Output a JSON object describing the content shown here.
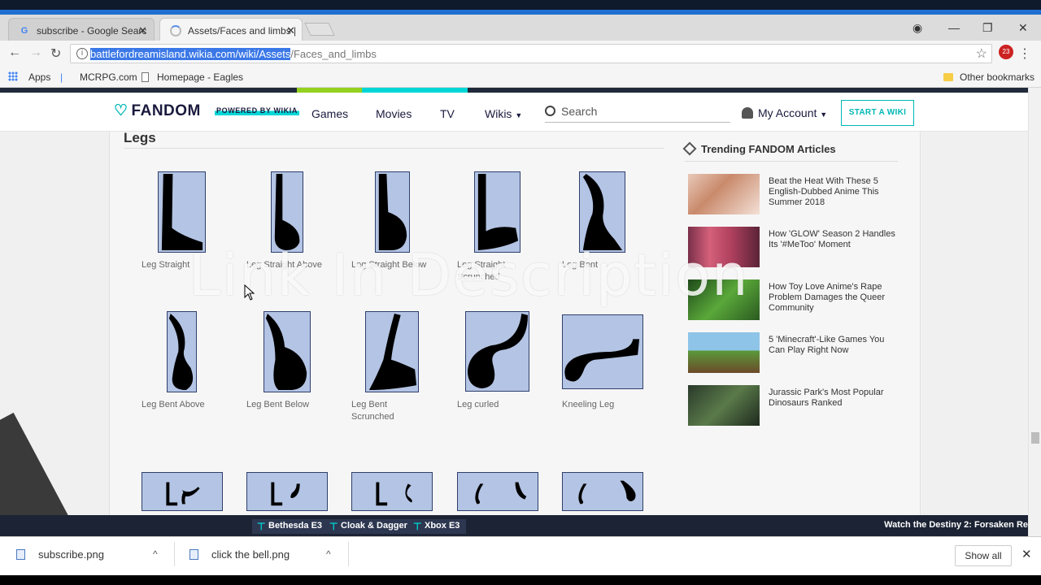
{
  "browser": {
    "tabs": [
      {
        "title": "subscribe - Google Searc",
        "favicon": "G",
        "active": false
      },
      {
        "title": "Assets/Faces and limbs |",
        "favicon": "",
        "active": true
      }
    ],
    "url_selected": "battlefordreamisland.wikia.com/wiki/Assets",
    "url_rest": "/Faces_and_limbs",
    "ext_badge": "23",
    "bookmarks": {
      "apps": "Apps",
      "mcrpg": "MCRPG.com",
      "eagles": "Homepage - Eagles",
      "other": "Other bookmarks"
    }
  },
  "fandom": {
    "logo": "FANDOM",
    "powered": "POWERED BY WIKIA",
    "nav": {
      "games": "Games",
      "movies": "Movies",
      "tv": "TV",
      "wikis": "Wikis"
    },
    "search_placeholder": "Search",
    "account": "My Account",
    "start_wiki": "START A WIKI"
  },
  "content": {
    "section_title": "Legs",
    "row1": [
      {
        "caption": "Leg Straight"
      },
      {
        "caption": "Leg Straight Above"
      },
      {
        "caption": "Leg Straight Below"
      },
      {
        "caption": "Leg Straight Scrunched"
      },
      {
        "caption": "Leg Bent"
      }
    ],
    "row2": [
      {
        "caption": "Leg Bent Above"
      },
      {
        "caption": "Leg Bent Below"
      },
      {
        "caption": "Leg Bent Scrunched"
      },
      {
        "caption": "Leg curled"
      },
      {
        "caption": "Kneeling Leg"
      }
    ]
  },
  "trending": {
    "title": "Trending FANDOM Articles",
    "articles": [
      {
        "title": "Beat the Heat With These 5 English-Dubbed Anime This Summer 2018"
      },
      {
        "title": "How 'GLOW' Season 2 Handles Its '#MeToo' Moment"
      },
      {
        "title": "How Toy Love Anime's Rape Problem Damages the Queer Community"
      },
      {
        "title": "5 'Minecraft'-Like Games You Can Play Right Now"
      },
      {
        "title": "Jurassic Park's Most Popular Dinosaurs Ranked"
      }
    ]
  },
  "overlay_text": "Link In Description",
  "hubbar": {
    "items": [
      "Bethesda E3",
      "Cloak & Dagger",
      "Xbox E3"
    ],
    "right": "Watch the Destiny 2: Forsaken Re"
  },
  "downloads": {
    "items": [
      "subscribe.png",
      "click the bell.png"
    ],
    "show_all": "Show all"
  }
}
